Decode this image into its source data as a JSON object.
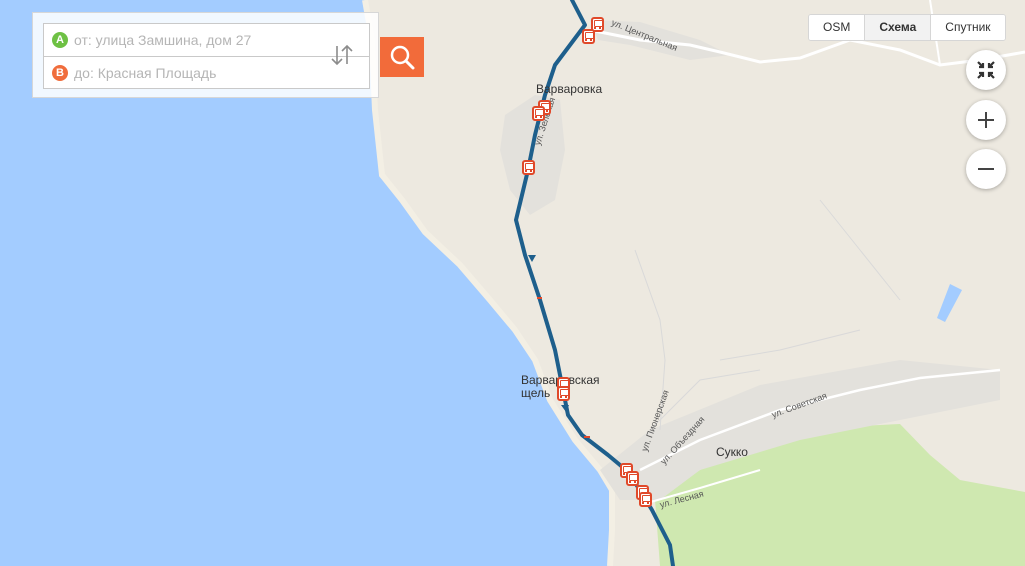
{
  "route_panel": {
    "from": {
      "marker": "A",
      "placeholder": "от: улица Замшина, дом 27",
      "value": ""
    },
    "to": {
      "marker": "B",
      "placeholder": "до: Красная Площадь",
      "value": ""
    },
    "swap_icon": "swap-vertical-icon",
    "search_icon": "search-icon"
  },
  "layers": {
    "items": [
      "OSM",
      "Схема",
      "Спутник"
    ],
    "active": "Схема"
  },
  "controls": {
    "fullscreen_icon": "collapse-icon",
    "zoom_in_icon": "plus-icon",
    "zoom_out_icon": "minus-icon"
  },
  "map": {
    "places": {
      "varvarovka": "Варваровка",
      "shchel": "Варваровская щель",
      "sukko": "Сукко"
    },
    "streets": {
      "central": "ул. Центральная",
      "green": "ул. Зелёная",
      "pioneer": "ул. Пионерская",
      "bypass": "ул. Объездная",
      "soviet": "ул. Советская",
      "forest": "ул. Лесная"
    }
  },
  "colors": {
    "sea": "#a3ccff",
    "land": "#ede9e0",
    "forest": "#cfe8b0",
    "route": "#1e5f8c",
    "accent": "#f26b3a",
    "marker_a": "#6ec144",
    "marker_b": "#f06d3c"
  }
}
